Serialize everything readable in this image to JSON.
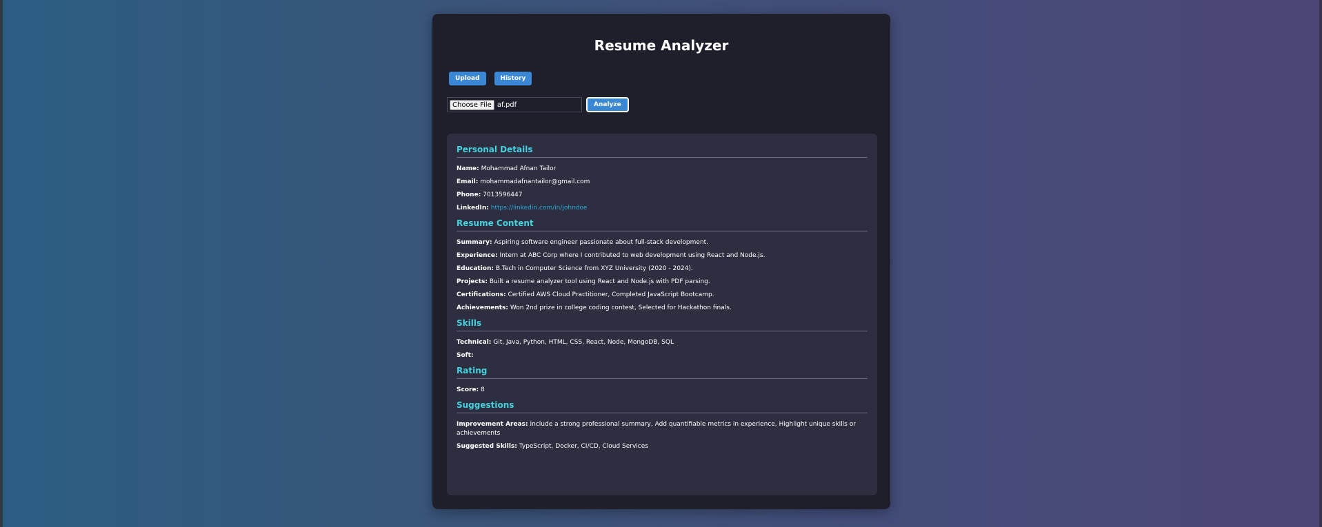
{
  "app": {
    "title": "Resume Analyzer"
  },
  "nav": {
    "upload_label": "Upload",
    "history_label": "History"
  },
  "upload": {
    "choose_label": "Choose File",
    "file_name": "af.pdf",
    "analyze_label": "Analyze"
  },
  "personal": {
    "heading": "Personal Details",
    "name_label": "Name:",
    "name": "Mohammad Afnan Tailor",
    "email_label": "Email:",
    "email": "mohammadafnantailor@gmail.com",
    "phone_label": "Phone:",
    "phone": "7013596447",
    "linkedin_label": "LinkedIn:",
    "linkedin": "https://linkedin.com/in/johndoe"
  },
  "content": {
    "heading": "Resume Content",
    "summary_label": "Summary:",
    "summary": "Aspiring software engineer passionate about full-stack development.",
    "experience_label": "Experience:",
    "experience": "Intern at ABC Corp where I contributed to web development using React and Node.js.",
    "education_label": "Education:",
    "education": "B.Tech in Computer Science from XYZ University (2020 - 2024).",
    "projects_label": "Projects:",
    "projects": "Built a resume analyzer tool using React and Node.js with PDF parsing.",
    "certifications_label": "Certifications:",
    "certifications": "Certified AWS Cloud Practitioner, Completed JavaScript Bootcamp.",
    "achievements_label": "Achievements:",
    "achievements": "Won 2nd prize in college coding contest, Selected for Hackathon finals."
  },
  "skills": {
    "heading": "Skills",
    "technical_label": "Technical:",
    "technical": "Git, Java, Python, HTML, CSS, React, Node, MongoDB, SQL",
    "soft_label": "Soft:",
    "soft": ""
  },
  "rating": {
    "heading": "Rating",
    "score_label": "Score:",
    "score": "8"
  },
  "suggestions": {
    "heading": "Suggestions",
    "improvement_label": "Improvement Areas:",
    "improvement": "Include a strong professional summary, Add quantifiable metrics in experience, Highlight unique skills or achievements",
    "skills_label": "Suggested Skills:",
    "skills": "TypeScript, Docker, CI/CD, Cloud Services"
  },
  "colors": {
    "accent": "#3a87d4",
    "heading": "#45d1dd",
    "link": "#2aa7d6",
    "card_bg": "#1f1f2c",
    "panel_bg": "#2e2e41"
  }
}
